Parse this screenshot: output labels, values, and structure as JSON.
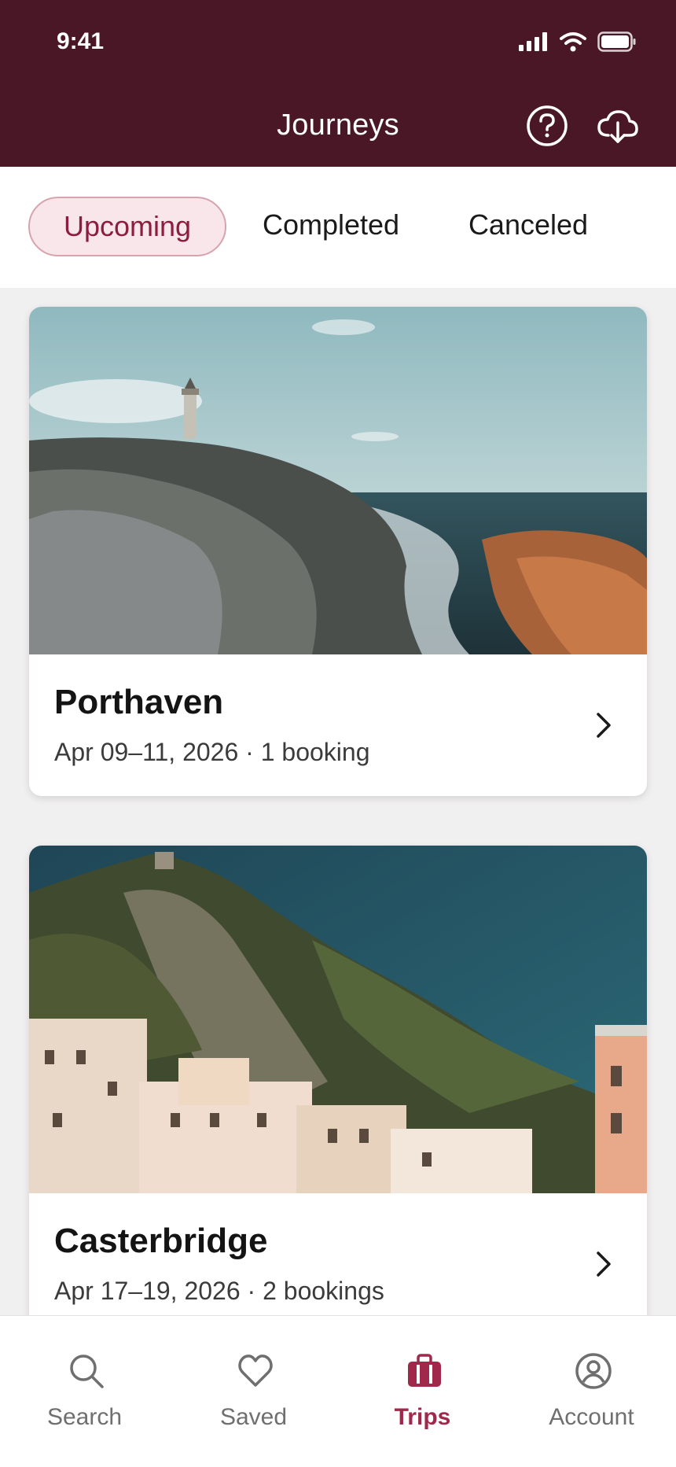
{
  "status_bar": {
    "time": "9:41"
  },
  "header": {
    "title": "Journeys",
    "help_icon": "help-circle-icon",
    "download_icon": "cloud-download-icon"
  },
  "tabs": [
    {
      "label": "Upcoming",
      "active": true
    },
    {
      "label": "Completed",
      "active": false
    },
    {
      "label": "Canceled",
      "active": false
    }
  ],
  "trips": [
    {
      "title": "Porthaven",
      "subtitle": "Apr 09–11, 2026 · 1 booking",
      "image": "coastal-lighthouse-cliffs"
    },
    {
      "title": "Casterbridge",
      "subtitle": "Apr 17–19, 2026 · 2 bookings",
      "image": "hillside-village"
    }
  ],
  "bottom_nav": [
    {
      "label": "Search",
      "icon": "search-icon",
      "active": false
    },
    {
      "label": "Saved",
      "icon": "heart-icon",
      "active": false
    },
    {
      "label": "Trips",
      "icon": "suitcase-icon",
      "active": true
    },
    {
      "label": "Account",
      "icon": "user-circle-icon",
      "active": false
    }
  ],
  "colors": {
    "header_bg": "#4a1726",
    "accent": "#a0284b",
    "active_tab_bg": "#f9e6ea"
  }
}
